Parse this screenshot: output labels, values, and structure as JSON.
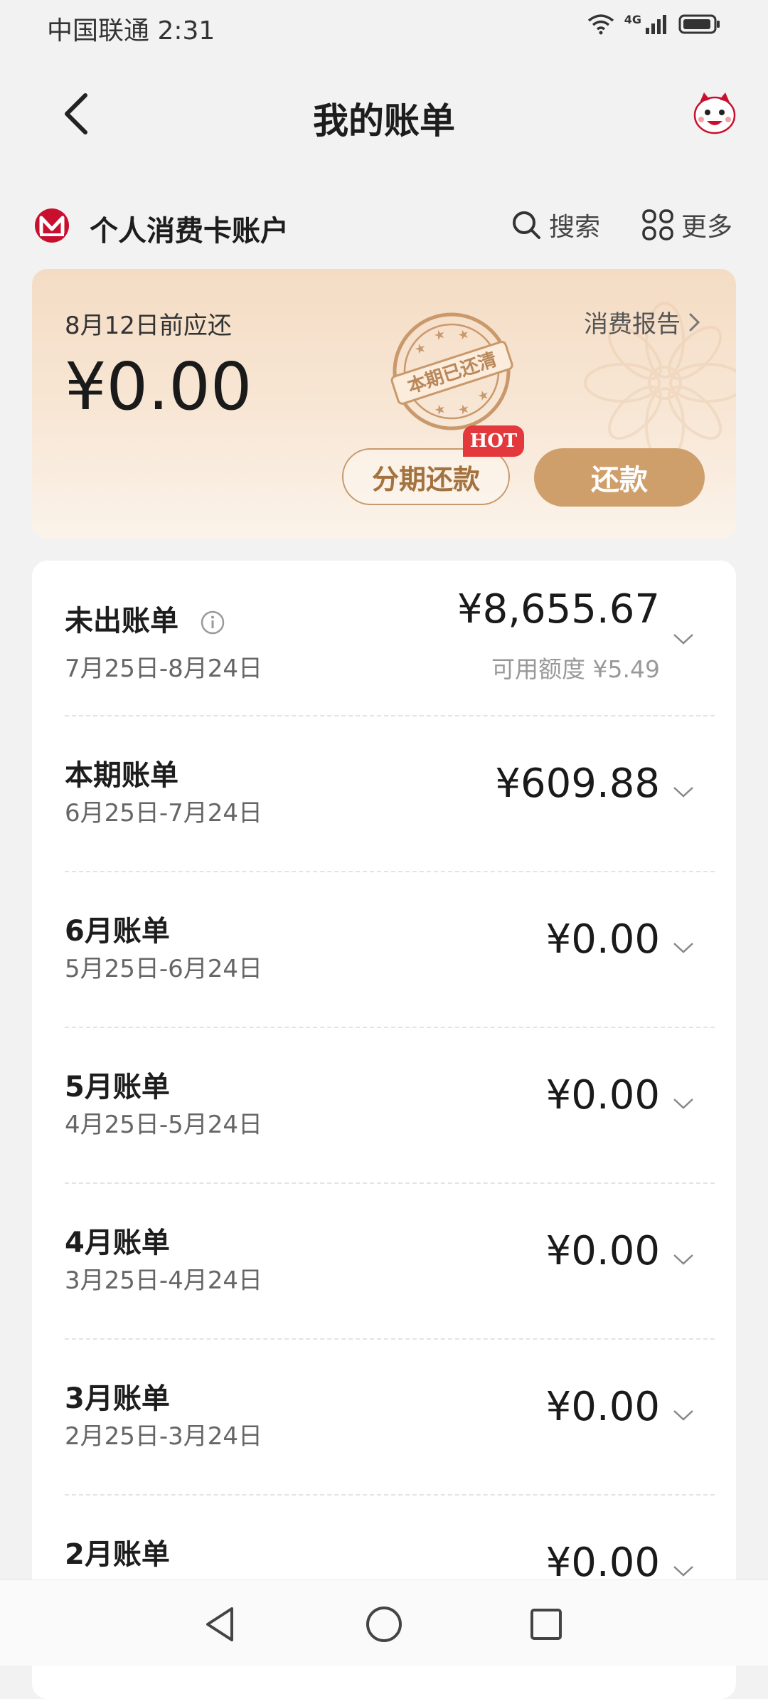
{
  "status_bar": {
    "carrier_time": "中国联通 2:31",
    "network_label": "4G"
  },
  "header": {
    "title": "我的账单"
  },
  "account": {
    "name": "个人消费卡账户",
    "search_label": "搜索",
    "more_label": "更多"
  },
  "due_card": {
    "due_date_label": "8月12日前应还",
    "due_amount": "¥0.00",
    "report_label": "消费报告",
    "stamp_text": "本期已还清",
    "installment_label": "分期还款",
    "hot_badge": "HOT",
    "repay_label": "还款"
  },
  "bills": [
    {
      "title": "未出账单",
      "period": "7月25日-8月24日",
      "amount": "¥8,655.67",
      "sub": "可用额度 ¥5.49"
    },
    {
      "title": "本期账单",
      "period": "6月25日-7月24日",
      "amount": "¥609.88"
    },
    {
      "title": "6月账单",
      "period": "5月25日-6月24日",
      "amount": "¥0.00"
    },
    {
      "title": "5月账单",
      "period": "4月25日-5月24日",
      "amount": "¥0.00"
    },
    {
      "title": "4月账单",
      "period": "3月25日-4月24日",
      "amount": "¥0.00"
    },
    {
      "title": "3月账单",
      "period": "2月25日-3月24日",
      "amount": "¥0.00"
    },
    {
      "title": "2月账单",
      "amount": "¥0.00"
    }
  ],
  "colors": {
    "accent": "#cf9f6b",
    "accent_text": "#a3723f",
    "bank_red": "#c8102e",
    "hot_red": "#e4393c"
  }
}
